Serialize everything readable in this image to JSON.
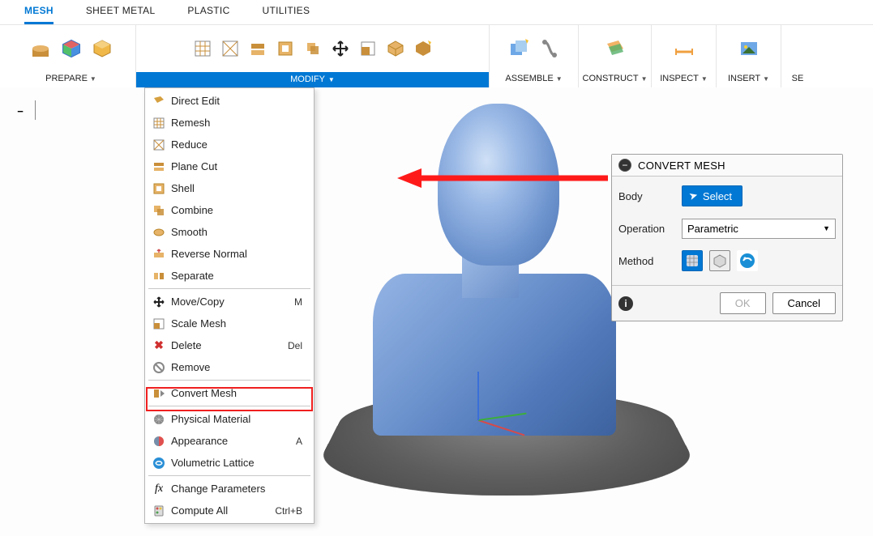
{
  "tabs": {
    "mesh": "MESH",
    "sheetmetal": "SHEET METAL",
    "plastic": "PLASTIC",
    "utilities": "UTILITIES"
  },
  "toolbar": {
    "prepare": "PREPARE",
    "modify": "MODIFY",
    "assemble": "ASSEMBLE",
    "construct": "CONSTRUCT",
    "inspect": "INSPECT",
    "insert": "INSERT",
    "select_partial": "SE"
  },
  "modify_menu": {
    "direct_edit": "Direct Edit",
    "remesh": "Remesh",
    "reduce": "Reduce",
    "plane_cut": "Plane Cut",
    "shell": "Shell",
    "combine": "Combine",
    "smooth": "Smooth",
    "reverse_normal": "Reverse Normal",
    "separate": "Separate",
    "move_copy": "Move/Copy",
    "move_copy_key": "M",
    "scale_mesh": "Scale Mesh",
    "delete": "Delete",
    "delete_key": "Del",
    "remove": "Remove",
    "convert_mesh": "Convert Mesh",
    "physical_material": "Physical Material",
    "appearance": "Appearance",
    "appearance_key": "A",
    "volumetric_lattice": "Volumetric Lattice",
    "change_parameters": "Change Parameters",
    "compute_all": "Compute All",
    "compute_all_key": "Ctrl+B"
  },
  "convert_panel": {
    "title": "CONVERT MESH",
    "body_label": "Body",
    "select_btn": "Select",
    "operation_label": "Operation",
    "operation_value": "Parametric",
    "method_label": "Method",
    "ok": "OK",
    "cancel": "Cancel",
    "info": "i",
    "collapse_symbol": "−"
  },
  "left_minus": "−"
}
